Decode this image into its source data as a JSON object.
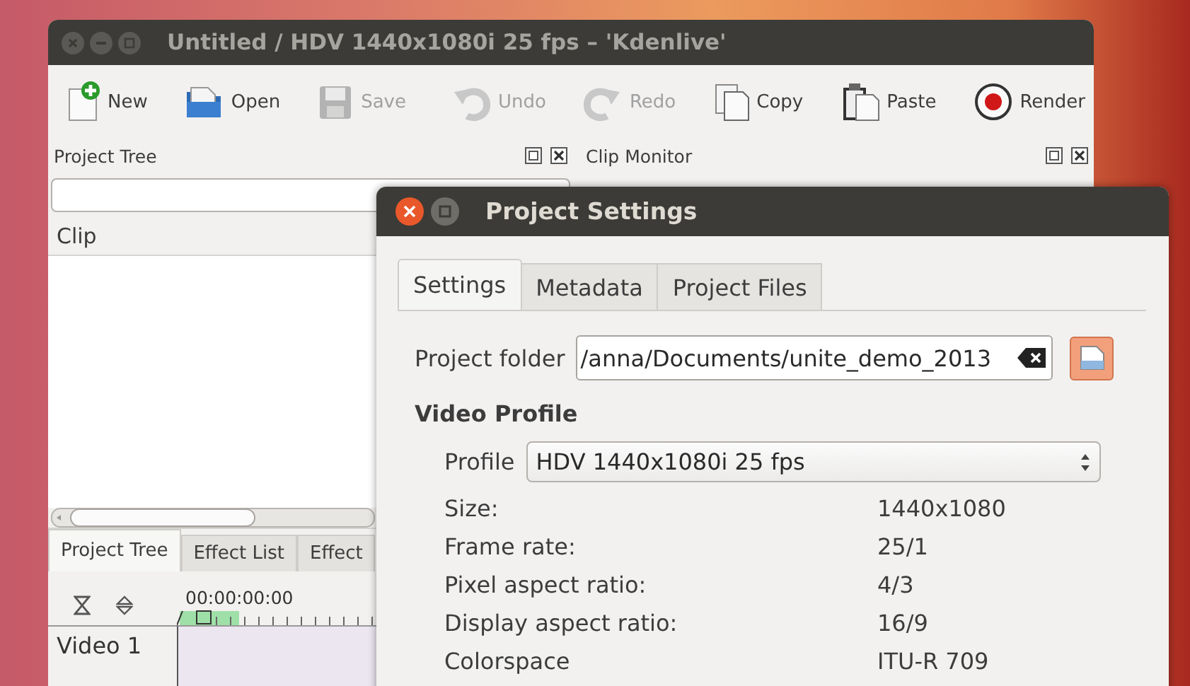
{
  "main_window": {
    "title": "Untitled / HDV 1440x1080i 25 fps – 'Kdenlive'",
    "toolbar": [
      {
        "kind": "new",
        "label": "New",
        "disabled": false
      },
      {
        "kind": "open",
        "label": "Open",
        "disabled": false
      },
      {
        "kind": "save",
        "label": "Save",
        "disabled": true
      },
      {
        "kind": "separator"
      },
      {
        "kind": "undo",
        "label": "Undo",
        "disabled": true
      },
      {
        "kind": "redo",
        "label": "Redo",
        "disabled": true
      },
      {
        "kind": "copy",
        "label": "Copy",
        "disabled": false
      },
      {
        "kind": "paste",
        "label": "Paste",
        "disabled": false
      },
      {
        "kind": "render",
        "label": "Render",
        "disabled": false
      }
    ],
    "project_tree": {
      "title": "Project Tree",
      "column": "Clip"
    },
    "clip_monitor": {
      "title": "Clip Monitor"
    },
    "bottom_tabs": [
      {
        "label": "Project Tree",
        "selected": true
      },
      {
        "label": "Effect List",
        "selected": false
      },
      {
        "label": "Effect",
        "selected": false
      }
    ],
    "timeline": {
      "timecode": "00:00:00:00",
      "tracks": [
        {
          "name": "Video 1"
        }
      ]
    }
  },
  "dialog": {
    "title": "Project Settings",
    "tabs": [
      {
        "label": "Settings",
        "selected": true
      },
      {
        "label": "Metadata",
        "selected": false
      },
      {
        "label": "Project Files",
        "selected": false
      }
    ],
    "project_folder": {
      "label": "Project folder",
      "value": "/anna/Documents/unite_demo_2013"
    },
    "section_title": "Video Profile",
    "profile": {
      "label": "Profile",
      "value": "HDV 1440x1080i 25 fps"
    },
    "properties": [
      {
        "label": "Size:",
        "value": "1440x1080"
      },
      {
        "label": "Frame rate:",
        "value": "25/1"
      },
      {
        "label": "Pixel aspect ratio:",
        "value": "4/3"
      },
      {
        "label": "Display aspect ratio:",
        "value": "16/9"
      },
      {
        "label": "Colorspace",
        "value": "ITU-R 709"
      }
    ]
  }
}
